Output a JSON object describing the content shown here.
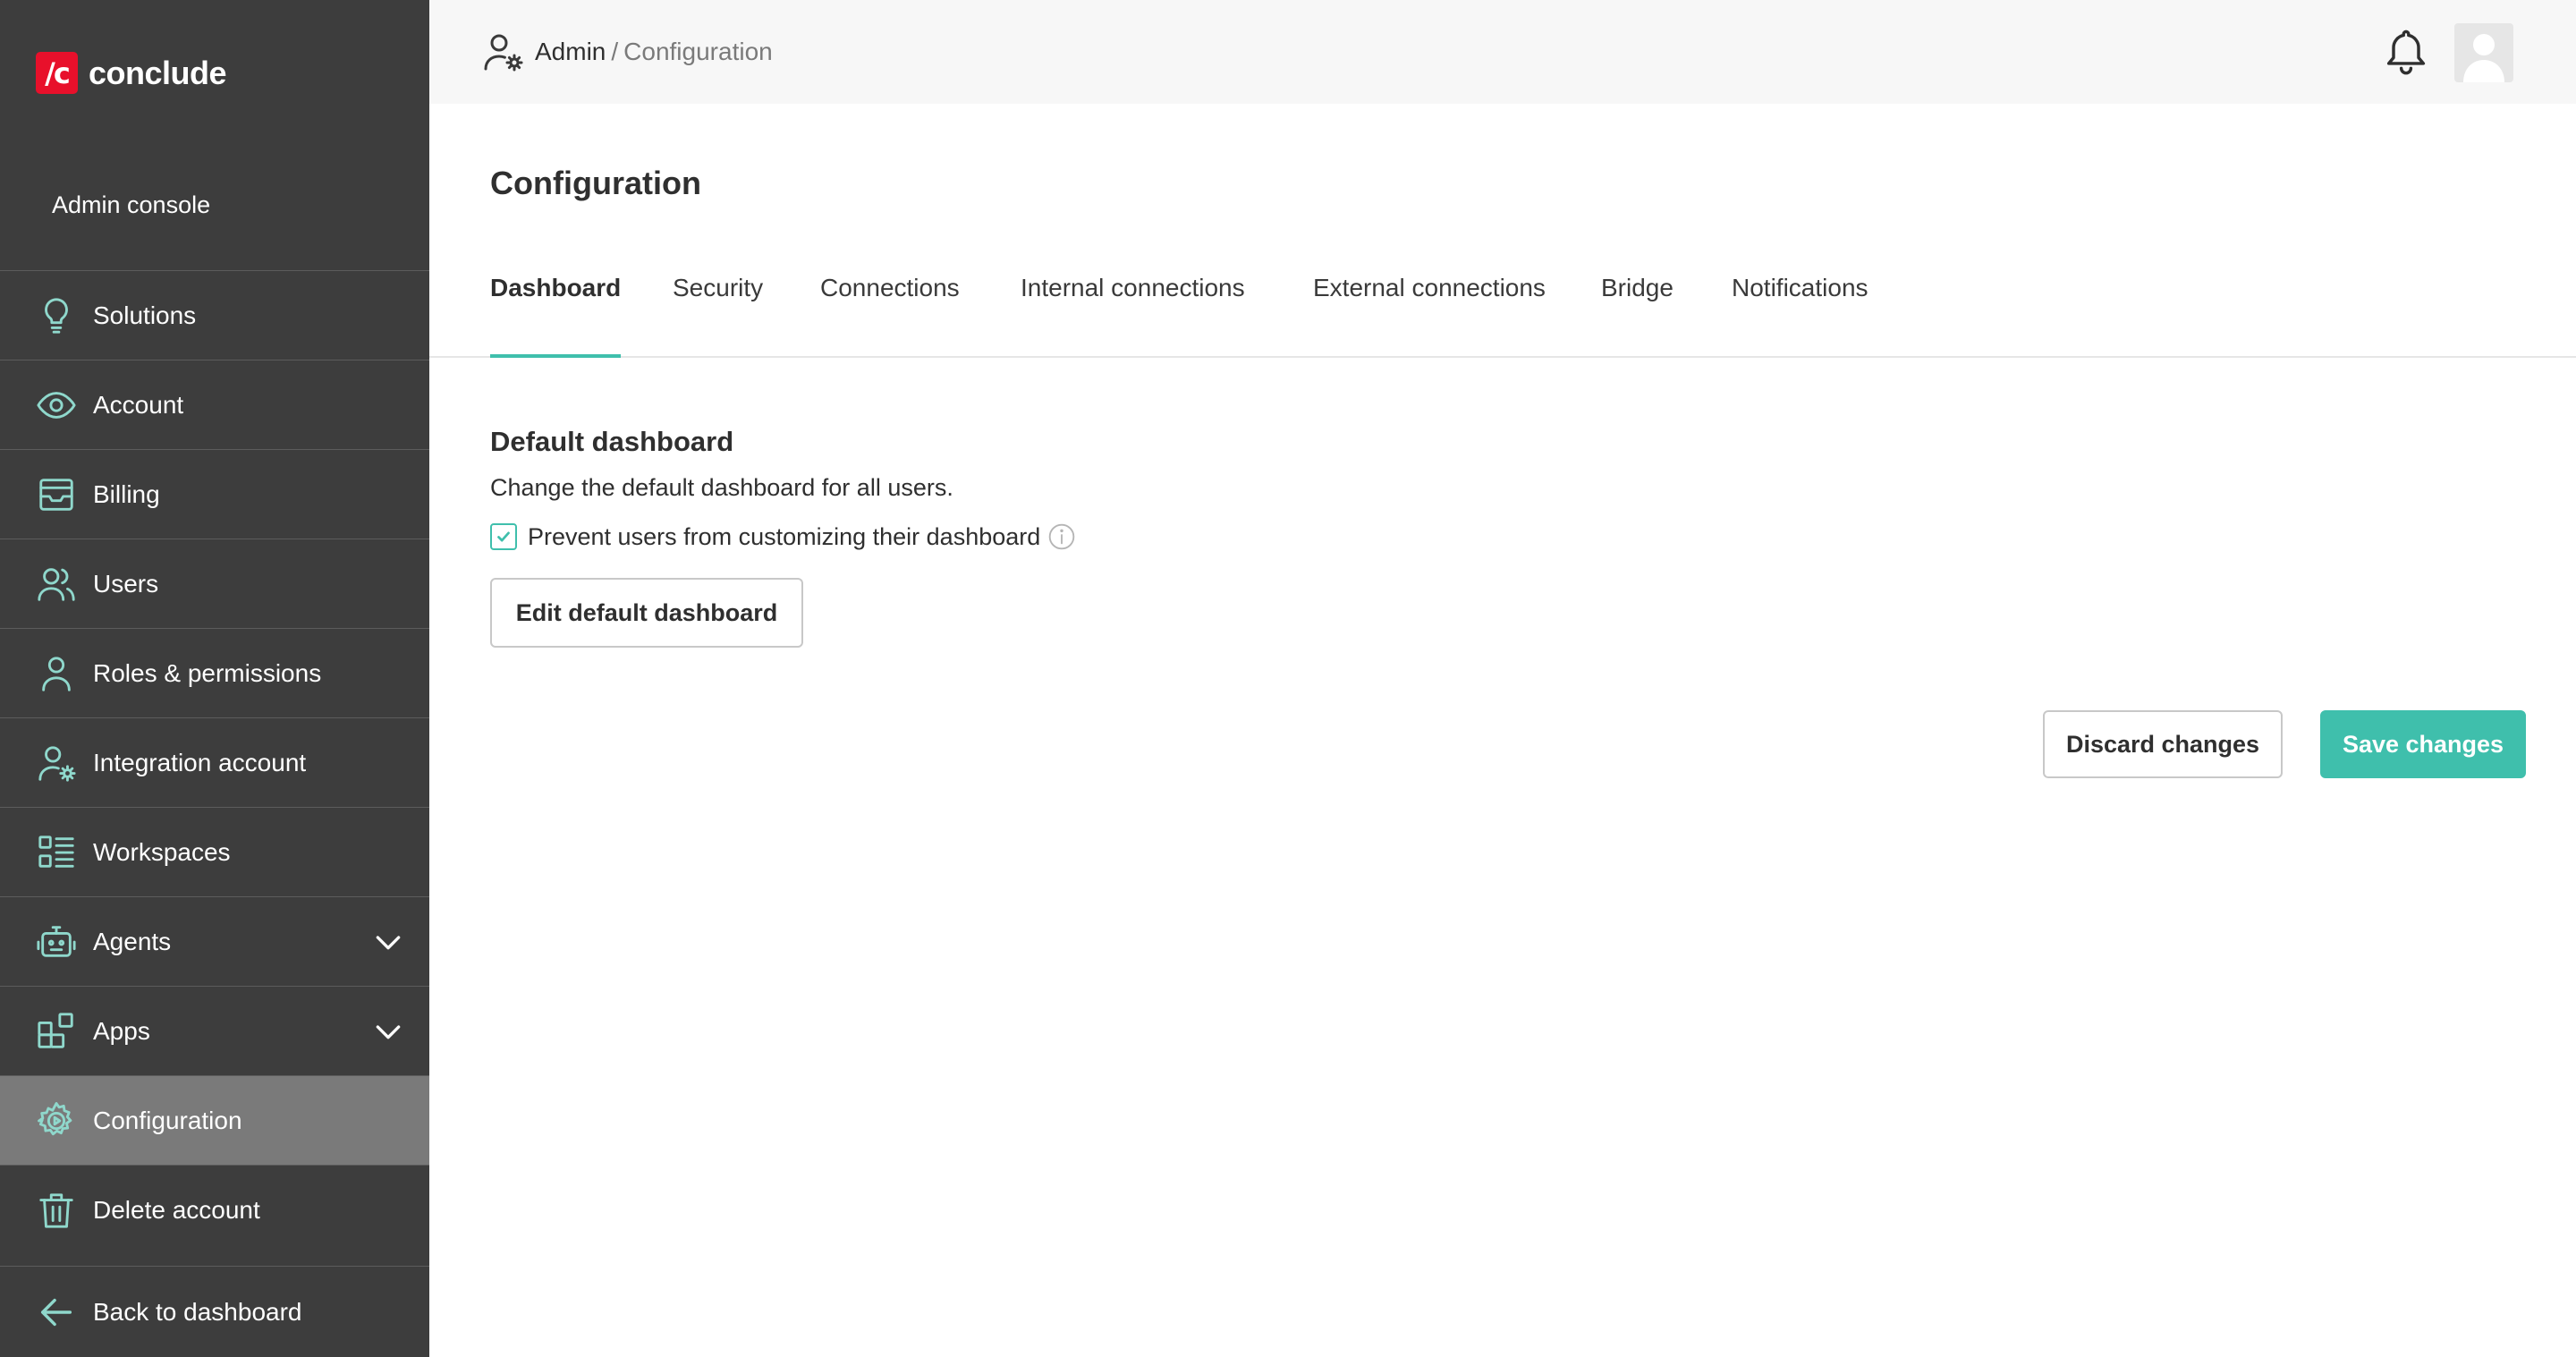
{
  "app": {
    "logo_mark": "/c",
    "logo_text": "conclude",
    "console_label": "Admin console"
  },
  "sidebar": {
    "items": [
      {
        "label": "Solutions",
        "icon": "lightbulb-icon"
      },
      {
        "label": "Account",
        "icon": "eye-icon"
      },
      {
        "label": "Billing",
        "icon": "inbox-icon"
      },
      {
        "label": "Users",
        "icon": "users-icon"
      },
      {
        "label": "Roles & permissions",
        "icon": "user-icon"
      },
      {
        "label": "Integration account",
        "icon": "user-gear-icon"
      },
      {
        "label": "Workspaces",
        "icon": "list-icon"
      },
      {
        "label": "Agents",
        "icon": "robot-icon",
        "expandable": true
      },
      {
        "label": "Apps",
        "icon": "apps-icon",
        "expandable": true
      },
      {
        "label": "Configuration",
        "icon": "gear-icon",
        "active": true
      },
      {
        "label": "Delete account",
        "icon": "trash-icon"
      }
    ],
    "back_label": "Back to dashboard"
  },
  "header": {
    "breadcrumb_root": "Admin",
    "breadcrumb_sep": "/",
    "breadcrumb_current": "Configuration"
  },
  "main": {
    "title": "Configuration",
    "tabs": [
      {
        "label": "Dashboard",
        "active": true
      },
      {
        "label": "Security"
      },
      {
        "label": "Connections"
      },
      {
        "label": "Internal connections"
      },
      {
        "label": "External connections"
      },
      {
        "label": "Bridge"
      },
      {
        "label": "Notifications"
      }
    ],
    "section": {
      "title": "Default dashboard",
      "description": "Change the default dashboard for all users.",
      "checkbox_label": "Prevent users from customizing their dashboard",
      "checkbox_checked": true,
      "edit_button": "Edit default dashboard"
    },
    "discard_button": "Discard changes",
    "save_button": "Save changes"
  },
  "colors": {
    "sidebar_bg": "#3d3d3d",
    "sidebar_active": "#7a7a7a",
    "accent": "#3fbfac",
    "brand": "#e8102b",
    "icon_stroke": "#8fd8cc"
  }
}
